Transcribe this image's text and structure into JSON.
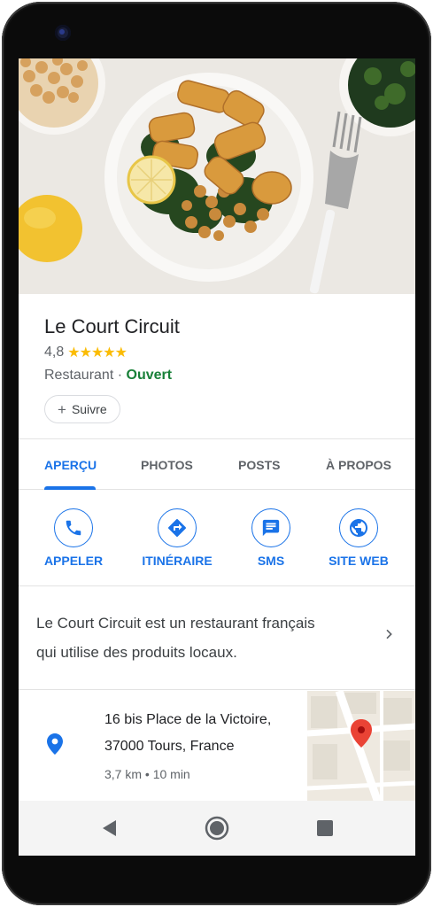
{
  "place": {
    "name": "Le Court Circuit",
    "rating": "4,8",
    "stars": "★★★★★",
    "category": "Restaurant",
    "separator": "·",
    "status": "Ouvert",
    "follow_label": "Suivre"
  },
  "tabs": [
    {
      "label": "APERÇU",
      "active": true
    },
    {
      "label": "PHOTOS",
      "active": false
    },
    {
      "label": "POSTS",
      "active": false
    },
    {
      "label": "À PROPOS",
      "active": false
    }
  ],
  "actions": [
    {
      "label": "APPELER",
      "icon": "phone-icon"
    },
    {
      "label": "ITINÉRAIRE",
      "icon": "directions-icon"
    },
    {
      "label": "SMS",
      "icon": "message-icon"
    },
    {
      "label": "SITE WEB",
      "icon": "globe-icon"
    }
  ],
  "description": {
    "line1": "Le Court Circuit est un restaurant français",
    "line2": "qui utilise des produits locaux."
  },
  "address": {
    "line1": "16 bis Place de la Victoire,",
    "line2": "37000 Tours, France",
    "distance": "3,7 km • 10 min"
  },
  "colors": {
    "accent": "#1a73e8",
    "open": "#188038",
    "star": "#fbbc04",
    "pin_red": "#ea4335"
  }
}
